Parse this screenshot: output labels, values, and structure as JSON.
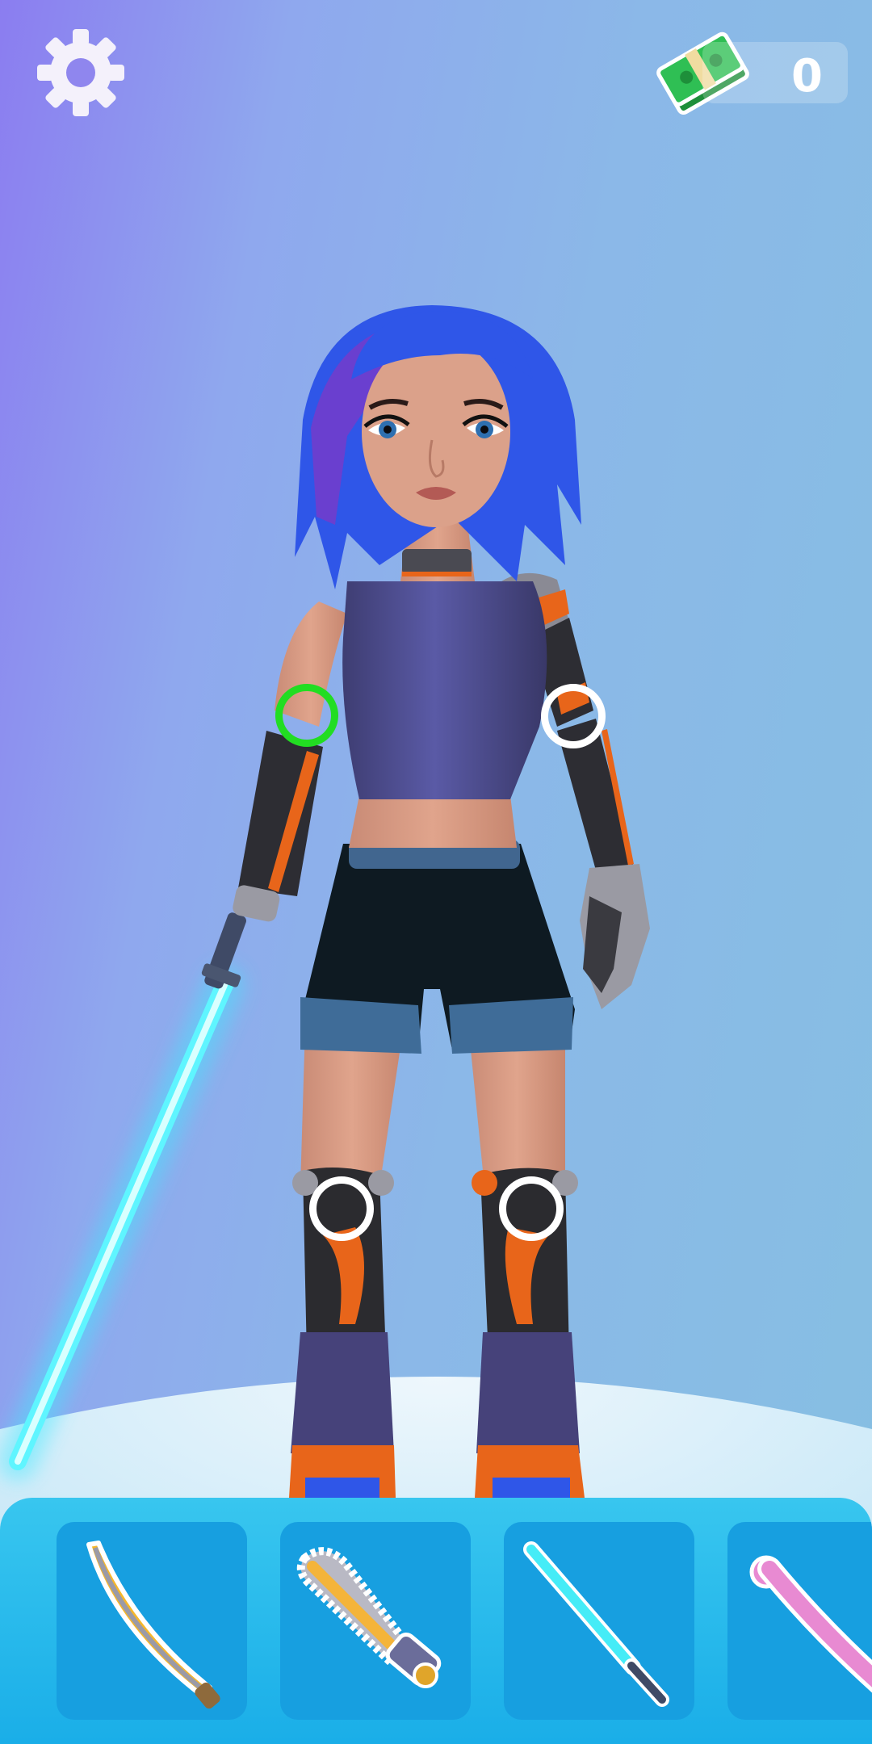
{
  "hud": {
    "settings_icon": "gear-icon",
    "money_icon": "cash-stack-icon",
    "money_value": "0"
  },
  "character": {
    "joint_markers": [
      {
        "name": "left-elbow-marker",
        "state": "selected",
        "color": "#22dd22"
      },
      {
        "name": "right-elbow-marker",
        "state": "available",
        "color": "#ffffff"
      },
      {
        "name": "left-knee-marker",
        "state": "available",
        "color": "#ffffff"
      },
      {
        "name": "right-knee-marker",
        "state": "available",
        "color": "#ffffff"
      }
    ],
    "equipped_weapon": "lightsaber"
  },
  "weapon_tray": {
    "items": [
      {
        "id": "golden-sword",
        "icon": "curved-sword-icon"
      },
      {
        "id": "chainsaw",
        "icon": "chainsaw-icon"
      },
      {
        "id": "lightsaber",
        "icon": "lightsaber-icon"
      },
      {
        "id": "pink-bat",
        "icon": "bat-icon"
      }
    ]
  },
  "colors": {
    "tray": "#1aaee8",
    "slot": "#179fe0",
    "saber_glow": "#4ff3ff",
    "hair": "#2f56e8",
    "selected_marker": "#22dd22"
  }
}
